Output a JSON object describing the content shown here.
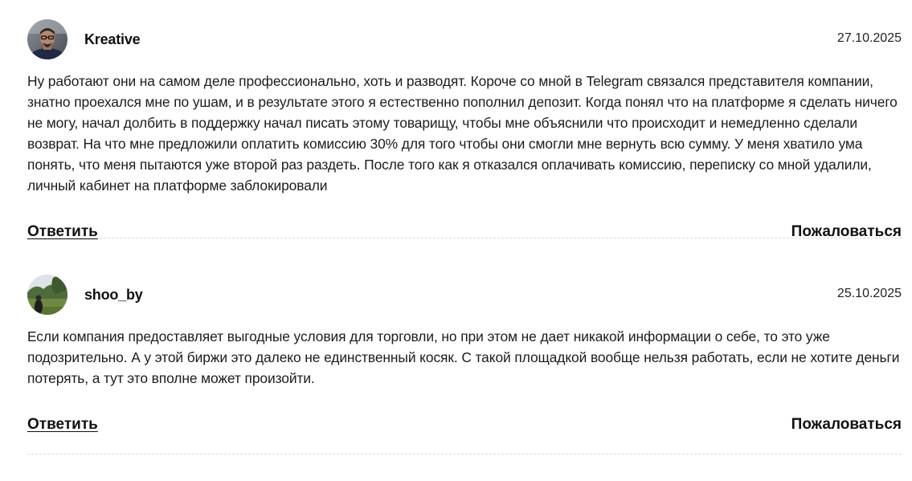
{
  "comments": [
    {
      "author": "Kreative",
      "avatar": "user-photo-man-glasses",
      "date": "27.10.2025",
      "text": "Ну работают они на самом деле профессионально, хоть и разводят. Короче со мной в Telegram связался представителя компании, знатно проехался мне по ушам, и в результате этого я естественно пополнил депозит. Когда понял что на платформе я сделать ничего не могу, начал долбить в поддержку начал писать этому товарищу, чтобы мне объяснили что происходит и немедленно сделали возврат. На что мне предложили оплатить комиссию 30% для того чтобы они смогли мне вернуть всю сумму. У меня хватило ума понять, что меня пытаются уже второй раз раздеть. После того как я отказался оплачивать комиссию, переписку со мной удалили, личный кабинет на платформе заблокировали",
      "reply_label": "Ответить",
      "report_label": "Пожаловаться"
    },
    {
      "author": "shoo_by",
      "avatar": "user-photo-landscape",
      "date": "25.10.2025",
      "text": "Если компания предоставляет выгодные условия для торговли, но при этом не дает никакой информации о себе, то это уже подозрительно. А у этой биржи это далеко не единственный косяк. С такой площадкой вообще нельзя работать, если не хотите деньги потерять, а тут это вполне может произойти.",
      "reply_label": "Ответить",
      "report_label": "Пожаловаться"
    }
  ],
  "colors": {
    "text": "#1c1c1c",
    "divider": "#d9d9d9",
    "background": "#ffffff"
  }
}
